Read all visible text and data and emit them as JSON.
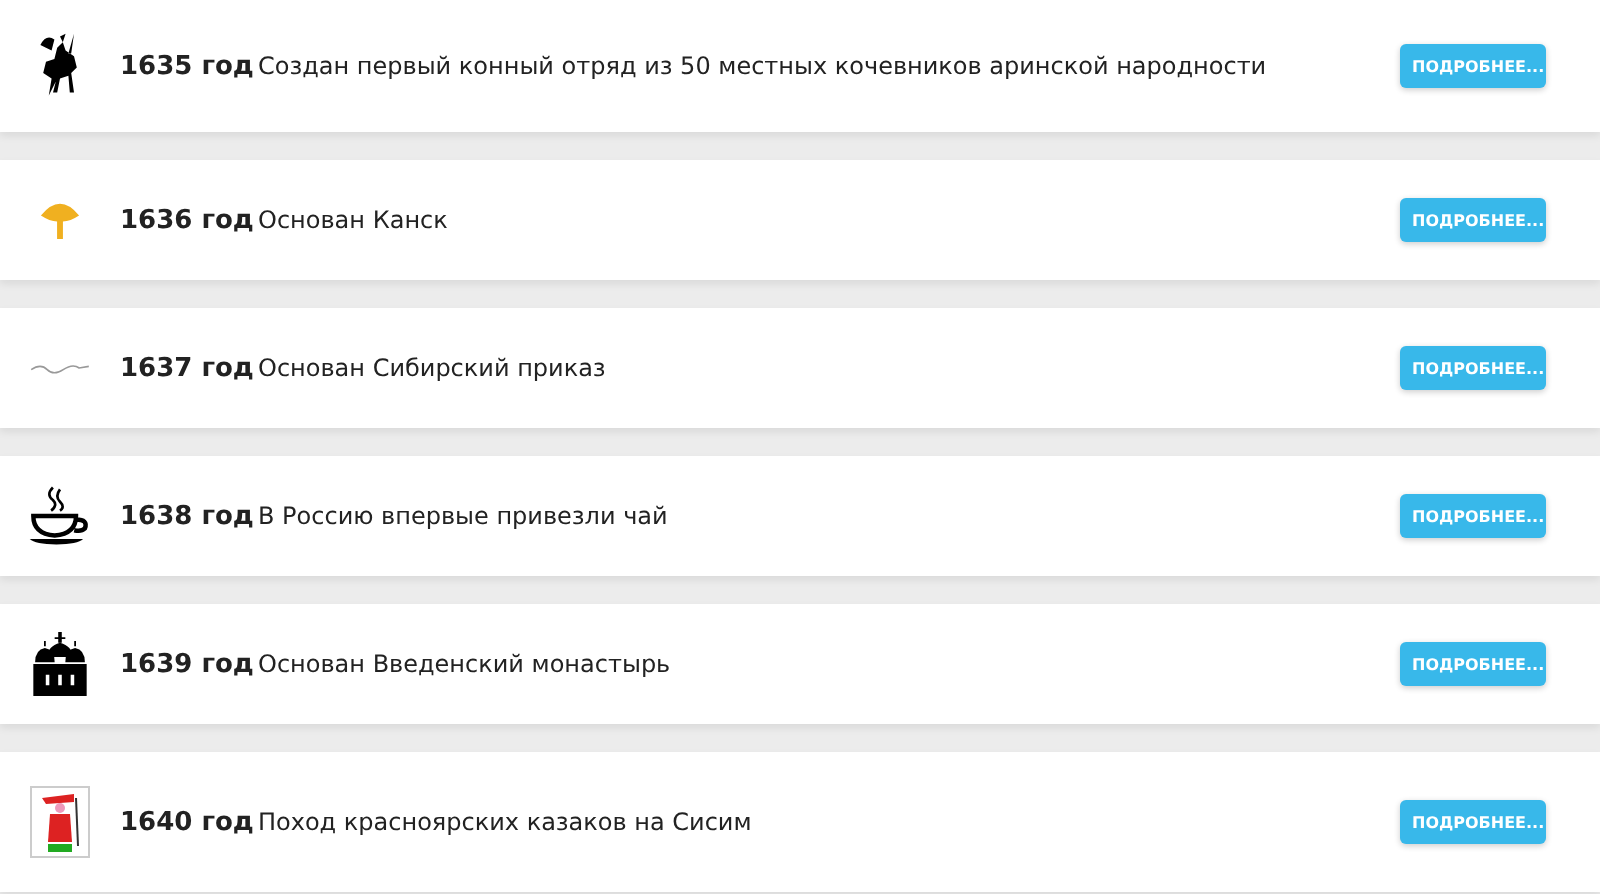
{
  "events": [
    {
      "year": "1635 год",
      "text": "Создан первый конный отряд из 50 местных кочевников аринской народности",
      "button": "ПОДРОБНЕЕ..."
    },
    {
      "year": "1636 год",
      "text": "Основан Канск",
      "button": "ПОДРОБНЕЕ..."
    },
    {
      "year": "1637 год",
      "text": "Основан Сибирский приказ",
      "button": "ПОДРОБНЕЕ..."
    },
    {
      "year": "1638 год",
      "text": "В Россию впервые привезли чай",
      "button": "ПОДРОБНЕЕ..."
    },
    {
      "year": "1639 год",
      "text": "Основан Введенский монастырь",
      "button": "ПОДРОБНЕЕ..."
    },
    {
      "year": "1640 год",
      "text": "Поход красноярских казаков на Сисим",
      "button": "ПОДРОБНЕЕ..."
    }
  ]
}
